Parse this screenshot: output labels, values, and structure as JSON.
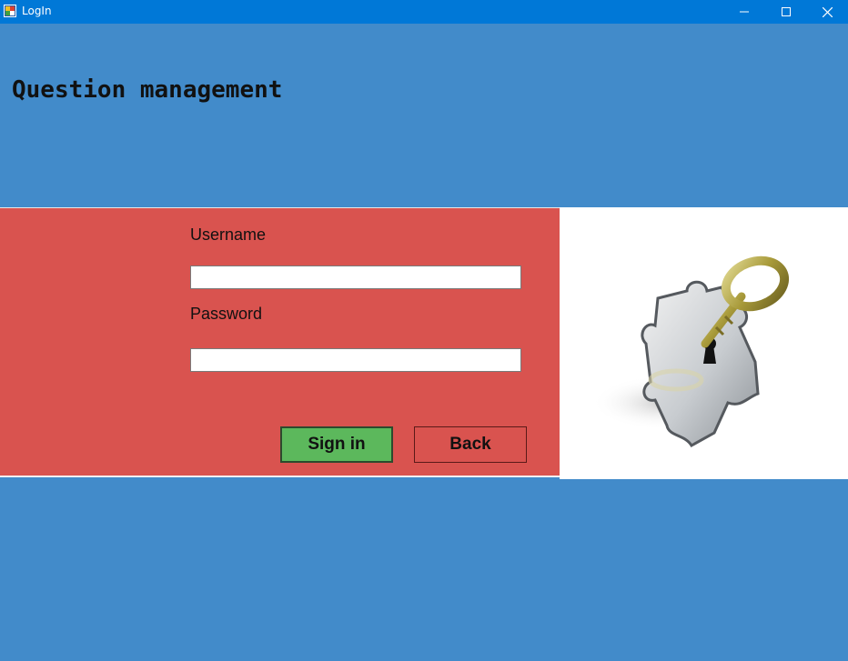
{
  "window": {
    "title": "LogIn",
    "icons": {
      "app": "app-icon",
      "minimize": "minimize-icon",
      "maximize": "maximize-icon",
      "close": "close-icon"
    }
  },
  "header": {
    "title": "Question management"
  },
  "login": {
    "username_label": "Username",
    "username_value": "",
    "password_label": "Password",
    "password_value": "",
    "signin_label": "Sign in",
    "back_label": "Back"
  },
  "image": {
    "icon": "puzzle-key-icon"
  },
  "colors": {
    "titlebar": "#0078d7",
    "background": "#428bca",
    "login_panel": "#d9534f",
    "signin_button": "#5cb85c",
    "image_panel": "#ffffff"
  }
}
